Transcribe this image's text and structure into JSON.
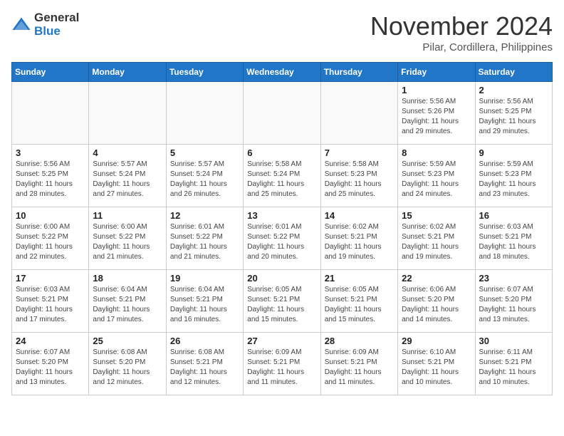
{
  "header": {
    "logo_general": "General",
    "logo_blue": "Blue",
    "month_title": "November 2024",
    "location": "Pilar, Cordillera, Philippines"
  },
  "weekdays": [
    "Sunday",
    "Monday",
    "Tuesday",
    "Wednesday",
    "Thursday",
    "Friday",
    "Saturday"
  ],
  "weeks": [
    [
      {
        "day": "",
        "info": ""
      },
      {
        "day": "",
        "info": ""
      },
      {
        "day": "",
        "info": ""
      },
      {
        "day": "",
        "info": ""
      },
      {
        "day": "",
        "info": ""
      },
      {
        "day": "1",
        "info": "Sunrise: 5:56 AM\nSunset: 5:26 PM\nDaylight: 11 hours\nand 29 minutes."
      },
      {
        "day": "2",
        "info": "Sunrise: 5:56 AM\nSunset: 5:25 PM\nDaylight: 11 hours\nand 29 minutes."
      }
    ],
    [
      {
        "day": "3",
        "info": "Sunrise: 5:56 AM\nSunset: 5:25 PM\nDaylight: 11 hours\nand 28 minutes."
      },
      {
        "day": "4",
        "info": "Sunrise: 5:57 AM\nSunset: 5:24 PM\nDaylight: 11 hours\nand 27 minutes."
      },
      {
        "day": "5",
        "info": "Sunrise: 5:57 AM\nSunset: 5:24 PM\nDaylight: 11 hours\nand 26 minutes."
      },
      {
        "day": "6",
        "info": "Sunrise: 5:58 AM\nSunset: 5:24 PM\nDaylight: 11 hours\nand 25 minutes."
      },
      {
        "day": "7",
        "info": "Sunrise: 5:58 AM\nSunset: 5:23 PM\nDaylight: 11 hours\nand 25 minutes."
      },
      {
        "day": "8",
        "info": "Sunrise: 5:59 AM\nSunset: 5:23 PM\nDaylight: 11 hours\nand 24 minutes."
      },
      {
        "day": "9",
        "info": "Sunrise: 5:59 AM\nSunset: 5:23 PM\nDaylight: 11 hours\nand 23 minutes."
      }
    ],
    [
      {
        "day": "10",
        "info": "Sunrise: 6:00 AM\nSunset: 5:22 PM\nDaylight: 11 hours\nand 22 minutes."
      },
      {
        "day": "11",
        "info": "Sunrise: 6:00 AM\nSunset: 5:22 PM\nDaylight: 11 hours\nand 21 minutes."
      },
      {
        "day": "12",
        "info": "Sunrise: 6:01 AM\nSunset: 5:22 PM\nDaylight: 11 hours\nand 21 minutes."
      },
      {
        "day": "13",
        "info": "Sunrise: 6:01 AM\nSunset: 5:22 PM\nDaylight: 11 hours\nand 20 minutes."
      },
      {
        "day": "14",
        "info": "Sunrise: 6:02 AM\nSunset: 5:21 PM\nDaylight: 11 hours\nand 19 minutes."
      },
      {
        "day": "15",
        "info": "Sunrise: 6:02 AM\nSunset: 5:21 PM\nDaylight: 11 hours\nand 19 minutes."
      },
      {
        "day": "16",
        "info": "Sunrise: 6:03 AM\nSunset: 5:21 PM\nDaylight: 11 hours\nand 18 minutes."
      }
    ],
    [
      {
        "day": "17",
        "info": "Sunrise: 6:03 AM\nSunset: 5:21 PM\nDaylight: 11 hours\nand 17 minutes."
      },
      {
        "day": "18",
        "info": "Sunrise: 6:04 AM\nSunset: 5:21 PM\nDaylight: 11 hours\nand 17 minutes."
      },
      {
        "day": "19",
        "info": "Sunrise: 6:04 AM\nSunset: 5:21 PM\nDaylight: 11 hours\nand 16 minutes."
      },
      {
        "day": "20",
        "info": "Sunrise: 6:05 AM\nSunset: 5:21 PM\nDaylight: 11 hours\nand 15 minutes."
      },
      {
        "day": "21",
        "info": "Sunrise: 6:05 AM\nSunset: 5:21 PM\nDaylight: 11 hours\nand 15 minutes."
      },
      {
        "day": "22",
        "info": "Sunrise: 6:06 AM\nSunset: 5:20 PM\nDaylight: 11 hours\nand 14 minutes."
      },
      {
        "day": "23",
        "info": "Sunrise: 6:07 AM\nSunset: 5:20 PM\nDaylight: 11 hours\nand 13 minutes."
      }
    ],
    [
      {
        "day": "24",
        "info": "Sunrise: 6:07 AM\nSunset: 5:20 PM\nDaylight: 11 hours\nand 13 minutes."
      },
      {
        "day": "25",
        "info": "Sunrise: 6:08 AM\nSunset: 5:20 PM\nDaylight: 11 hours\nand 12 minutes."
      },
      {
        "day": "26",
        "info": "Sunrise: 6:08 AM\nSunset: 5:21 PM\nDaylight: 11 hours\nand 12 minutes."
      },
      {
        "day": "27",
        "info": "Sunrise: 6:09 AM\nSunset: 5:21 PM\nDaylight: 11 hours\nand 11 minutes."
      },
      {
        "day": "28",
        "info": "Sunrise: 6:09 AM\nSunset: 5:21 PM\nDaylight: 11 hours\nand 11 minutes."
      },
      {
        "day": "29",
        "info": "Sunrise: 6:10 AM\nSunset: 5:21 PM\nDaylight: 11 hours\nand 10 minutes."
      },
      {
        "day": "30",
        "info": "Sunrise: 6:11 AM\nSunset: 5:21 PM\nDaylight: 11 hours\nand 10 minutes."
      }
    ]
  ]
}
